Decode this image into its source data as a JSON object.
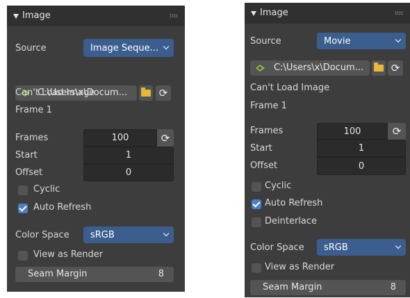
{
  "left": {
    "title": "Image",
    "source_label": "Source",
    "source_value": "Image Seque...",
    "path": "C:\\Users\\x\\Docum...",
    "status": "Can't Load Image",
    "frame_text": "Frame 1",
    "frames_label": "Frames",
    "frames_value": "100",
    "start_label": "Start",
    "start_value": "1",
    "offset_label": "Offset",
    "offset_value": "0",
    "cyclic_label": "Cyclic",
    "cyclic_checked": false,
    "auto_refresh_label": "Auto Refresh",
    "auto_refresh_checked": true,
    "color_space_label": "Color Space",
    "color_space_value": "sRGB",
    "view_as_render_label": "View as Render",
    "view_as_render_checked": false,
    "seam_margin_label": "Seam Margin",
    "seam_margin_value": "8"
  },
  "right": {
    "title": "Image",
    "source_label": "Source",
    "source_value": "Movie",
    "path": "C:\\Users\\x\\Docum...",
    "status": "Can't Load Image",
    "frame_text": "Frame 1",
    "frames_label": "Frames",
    "frames_value": "100",
    "start_label": "Start",
    "start_value": "1",
    "offset_label": "Offset",
    "offset_value": "0",
    "cyclic_label": "Cyclic",
    "cyclic_checked": false,
    "auto_refresh_label": "Auto Refresh",
    "auto_refresh_checked": true,
    "deinterlace_label": "Deinterlace",
    "deinterlace_checked": false,
    "color_space_label": "Color Space",
    "color_space_value": "sRGB",
    "view_as_render_label": "View as Render",
    "view_as_render_checked": false,
    "seam_margin_label": "Seam Margin",
    "seam_margin_value": "8"
  },
  "icons": {
    "collapse": "triangle-down-icon",
    "grip": "drag-grip-icon",
    "image": "image-file-icon",
    "folder": "folder-icon",
    "reload": "refresh-icon",
    "dropdown": "chevron-down-icon"
  },
  "colors": {
    "panel_bg": "#3d3d3d",
    "header_bg": "#303030",
    "accent_blue": "#3b5e8e",
    "checkbox_on": "#4a7fc1",
    "field_bg": "#2b2b2b",
    "folder_yellow": "#e9b73b"
  }
}
